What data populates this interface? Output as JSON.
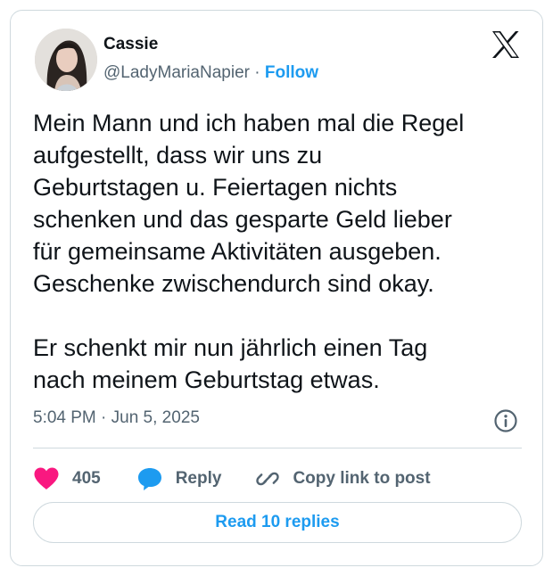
{
  "author": {
    "name": "Cassie",
    "handle": "@LadyMariaNapier",
    "separator": "·",
    "follow_label": "Follow",
    "avatar": "profile-photo"
  },
  "brand": {
    "logo_icon": "x-logo-icon"
  },
  "post": {
    "text": "Mein Mann und ich haben mal die Regel\naufgestellt, dass wir uns zu\nGeburtstagen u. Feiertagen nichts\nschenken und das gesparte Geld lieber\nfür gemeinsame Aktivitäten ausgeben.\nGeschenke zwischendurch sind okay.\n\nEr schenkt mir nun jährlich einen Tag\nnach meinem Geburtstag etwas.",
    "timestamp": "5:04 PM · Jun 5, 2025"
  },
  "actions": {
    "like_count": "405",
    "reply_label": "Reply",
    "copy_label": "Copy link to post"
  },
  "footer": {
    "read_replies_label": "Read 10 replies"
  },
  "colors": {
    "accent": "#1d9bf0",
    "like": "#f91880",
    "muted": "#536471",
    "text": "#0f1419",
    "border": "#cfd9de"
  }
}
